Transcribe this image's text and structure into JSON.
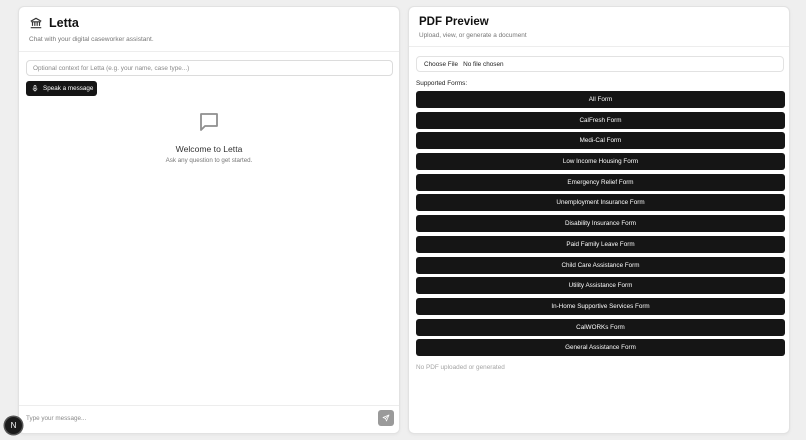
{
  "chat": {
    "title": "Letta",
    "subtitle": "Chat with your digital caseworker assistant.",
    "context_placeholder": "Optional context for Letta (e.g. your name, case type...)",
    "speak_label": "Speak a message",
    "welcome_title": "Welcome to Letta",
    "welcome_subtitle": "Ask any question to get started.",
    "message_placeholder": "Type your message..."
  },
  "pdf": {
    "title": "PDF Preview",
    "subtitle": "Upload, view, or generate a document",
    "choose_file_label": "Choose File",
    "no_file_label": "No file chosen",
    "supported_label": "Supported Forms:",
    "forms": [
      "All Form",
      "CalFresh Form",
      "Medi-Cal Form",
      "Low Income Housing Form",
      "Emergency Relief Form",
      "Unemployment Insurance Form",
      "Disability Insurance Form",
      "Paid Family Leave Form",
      "Child Care Assistance Form",
      "Utility Assistance Form",
      "In-Home Supportive Services Form",
      "CalWORKs Form",
      "General Assistance Form"
    ],
    "empty_state": "No PDF uploaded or generated"
  },
  "badge": {
    "letter": "N"
  },
  "colors": {
    "button_bg": "#151515",
    "send_bg": "#9a9a9a",
    "page_bg": "#efefef"
  },
  "icons": [
    "bank-icon",
    "microphone-icon",
    "chat-bubble-icon",
    "send-icon"
  ]
}
